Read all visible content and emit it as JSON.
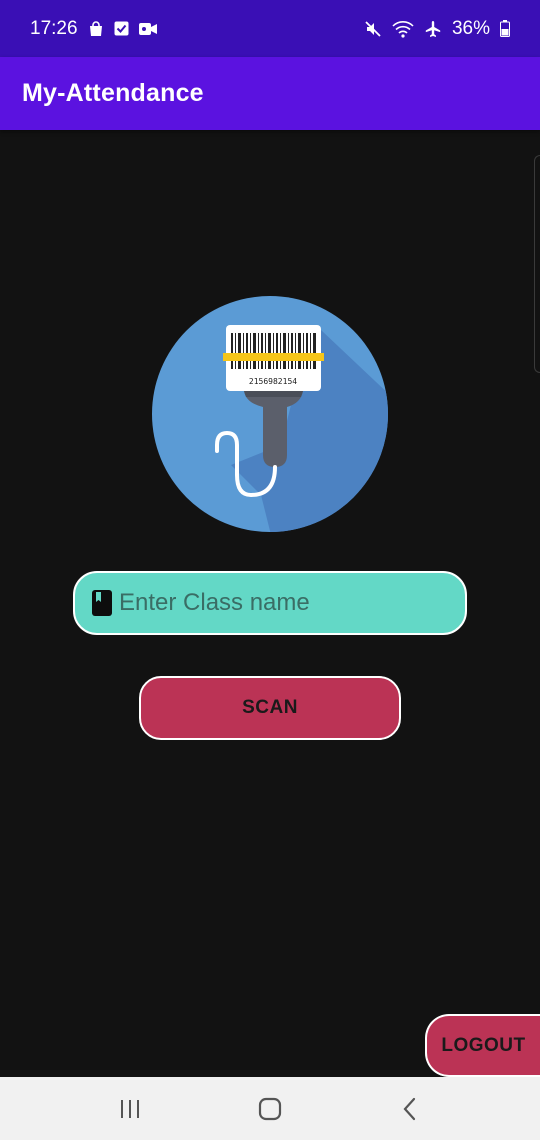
{
  "status_bar": {
    "time": "17:26",
    "battery": "36%",
    "left_icons": [
      "shopping-bag-icon",
      "checkbox-icon",
      "video-camera-icon"
    ],
    "right_icons": [
      "mute-icon",
      "wifi-icon",
      "airplane-icon",
      "battery-icon"
    ]
  },
  "app_bar": {
    "title": "My-Attendance"
  },
  "logo": {
    "icon": "barcode-scanner-icon",
    "barcode_digits": "2156982154"
  },
  "class_input": {
    "placeholder": "Enter Class name",
    "value": "",
    "icon": "book-icon"
  },
  "scan_button": {
    "label": "SCAN"
  },
  "logout_button": {
    "label": "LOGOUT"
  },
  "nav_bar": {
    "buttons": [
      "recent-apps-icon",
      "home-icon",
      "back-icon"
    ]
  },
  "colors": {
    "status_bar": "#3a0fb5",
    "app_bar": "#5b12e0",
    "background": "#121212",
    "input_bg": "#63d8c6",
    "button_bg": "#bb3355",
    "logo_circle": "#5b9bd5"
  }
}
